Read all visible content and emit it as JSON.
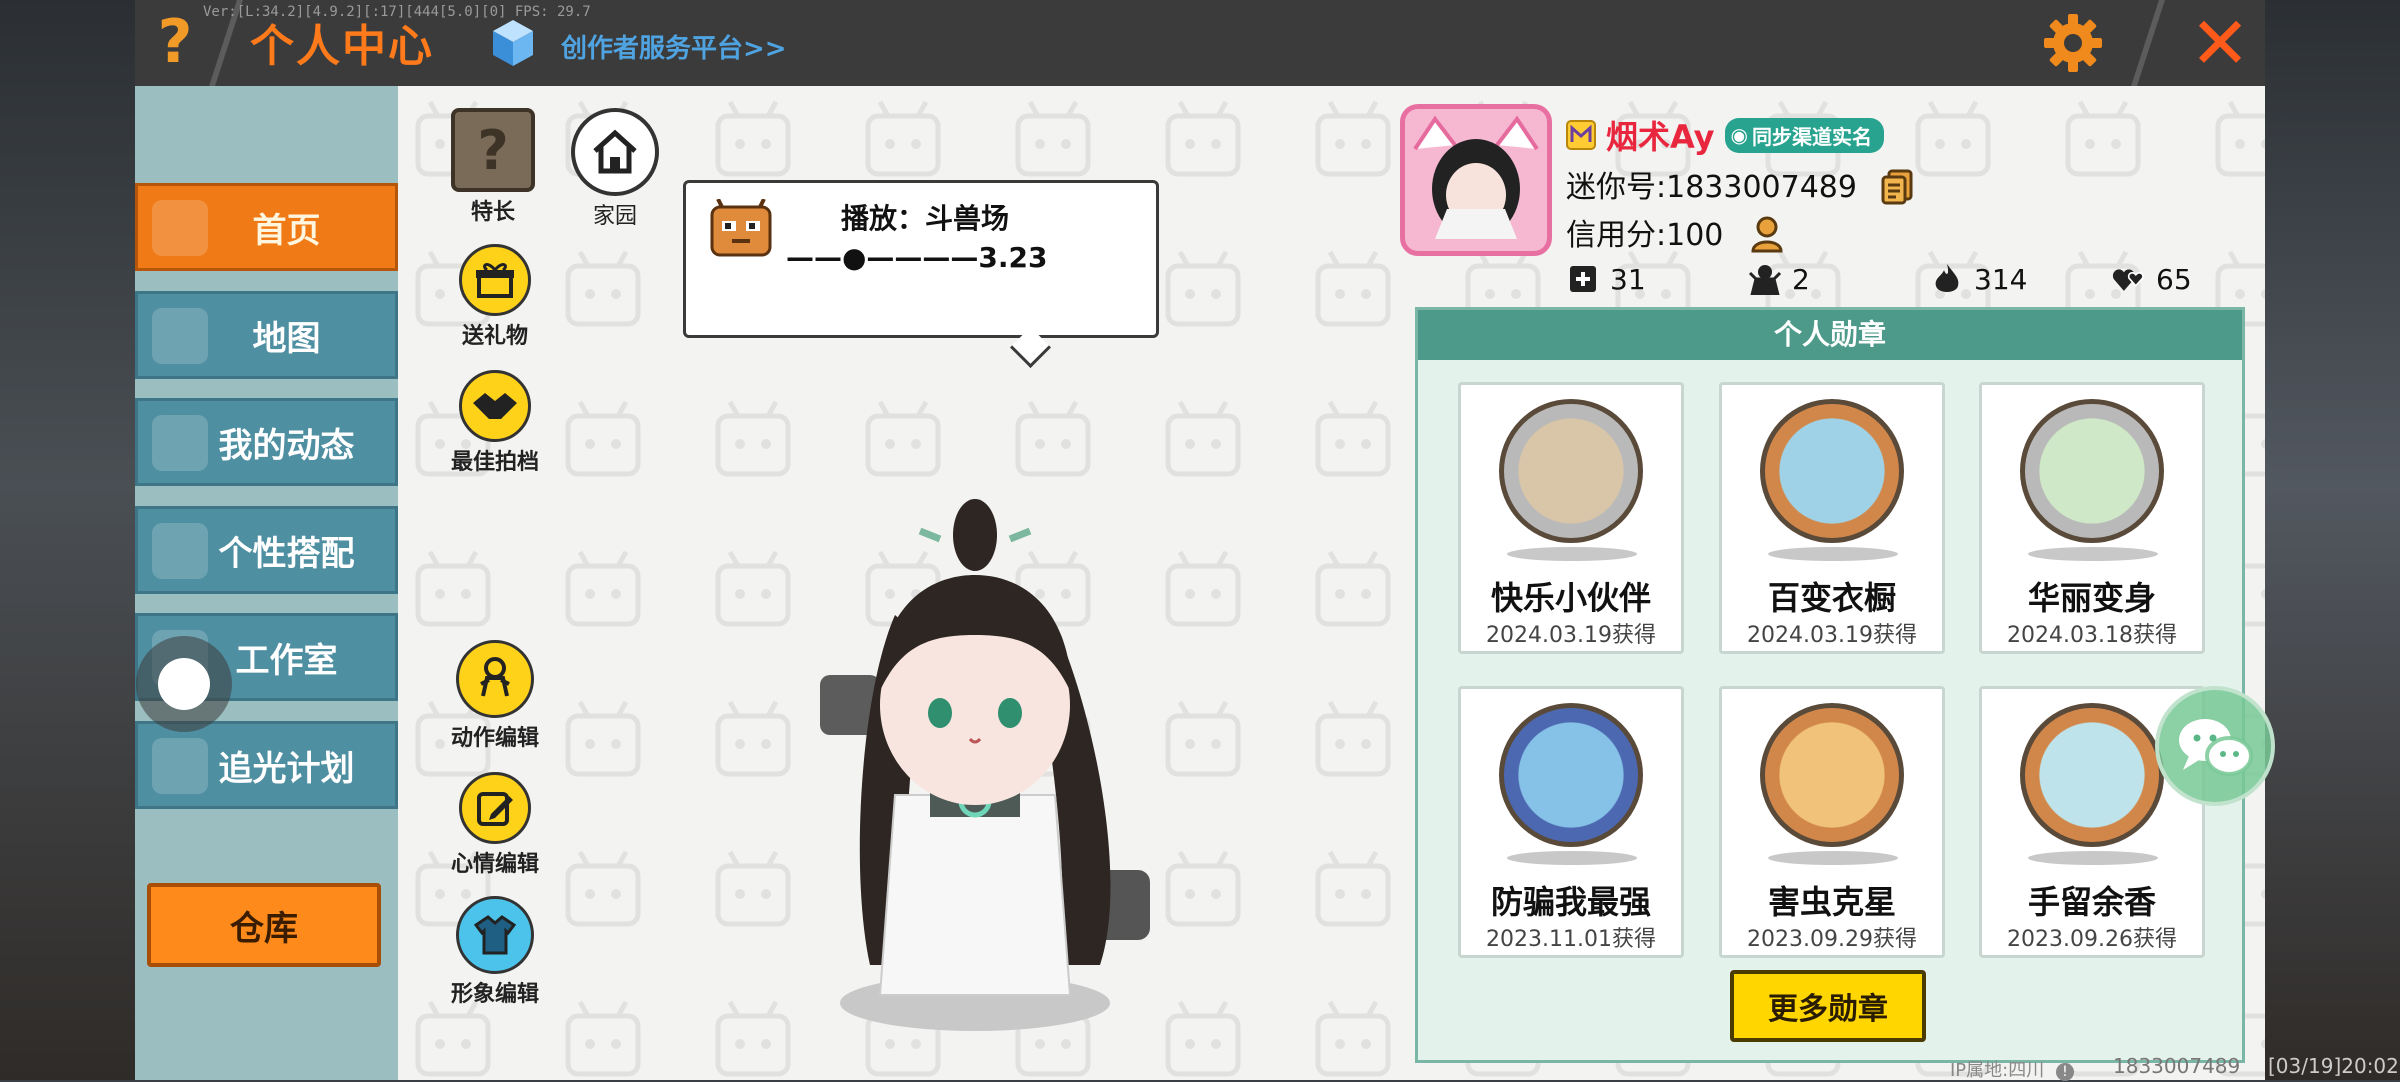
{
  "topbar": {
    "help_symbol": "?",
    "title": "个人中心",
    "version_text": "Ver:[L:34.2][4.9.2][:17][444[5.0][0] FPS: 29.7",
    "creator_link": "创作者服务平台>>",
    "close_symbol": "✕"
  },
  "sidebar": {
    "items": [
      {
        "label": "首页",
        "active": true
      },
      {
        "label": "地图",
        "active": false
      },
      {
        "label": "我的动态",
        "active": false
      },
      {
        "label": "个性搭配",
        "active": false
      },
      {
        "label": "工作室",
        "active": false
      },
      {
        "label": "追光计划",
        "active": false
      }
    ],
    "warehouse_label": "仓库"
  },
  "tools": {
    "specialty": "特长",
    "home": "家园",
    "gift": "送礼物",
    "partner": "最佳拍档",
    "action_edit": "动作编辑",
    "mood_edit": "心情编辑",
    "image_edit": "形象编辑"
  },
  "music": {
    "now_playing": "播放：斗兽场",
    "progress_text": "——●————3.23"
  },
  "profile": {
    "name": "烟术Ay",
    "sync_badge": "同步渠道实名",
    "uid_text": "迷你号:1833007489",
    "credit_text": "信用分:100",
    "stats": [
      {
        "icon": "plus-box-icon",
        "value": "31"
      },
      {
        "icon": "fans-icon",
        "value": "2"
      },
      {
        "icon": "flame-icon",
        "value": "314"
      },
      {
        "icon": "hearts-icon",
        "value": "65"
      }
    ]
  },
  "medals": {
    "header": "个人勋章",
    "items": [
      {
        "name": "快乐小伙伴",
        "date": "2024.03.19获得",
        "ring": "#b9b9b9",
        "inner": "#d9c6a8"
      },
      {
        "name": "百变衣橱",
        "date": "2024.03.19获得",
        "ring": "#d2874a",
        "inner": "#9fd2e6"
      },
      {
        "name": "华丽变身",
        "date": "2024.03.18获得",
        "ring": "#b9b9b9",
        "inner": "#cfe8c7"
      },
      {
        "name": "防骗我最强",
        "date": "2023.11.01获得",
        "ring": "#4b68b0",
        "inner": "#86c2e8"
      },
      {
        "name": "害虫克星",
        "date": "2023.09.29获得",
        "ring": "#d2874a",
        "inner": "#f0c27a"
      },
      {
        "name": "手留余香",
        "date": "2023.09.26获得",
        "ring": "#d2874a",
        "inner": "#bfe3ea"
      }
    ],
    "more_button": "更多勋章"
  },
  "footer": {
    "ip_location": "IP属地:四川",
    "uid": "1833007489",
    "time": "[03/19]20:02"
  },
  "colors": {
    "accent_orange": "#f07b16",
    "nav_blue": "#4f8fa2",
    "medal_green": "#4e9a8a",
    "name_red": "#e8273f"
  }
}
